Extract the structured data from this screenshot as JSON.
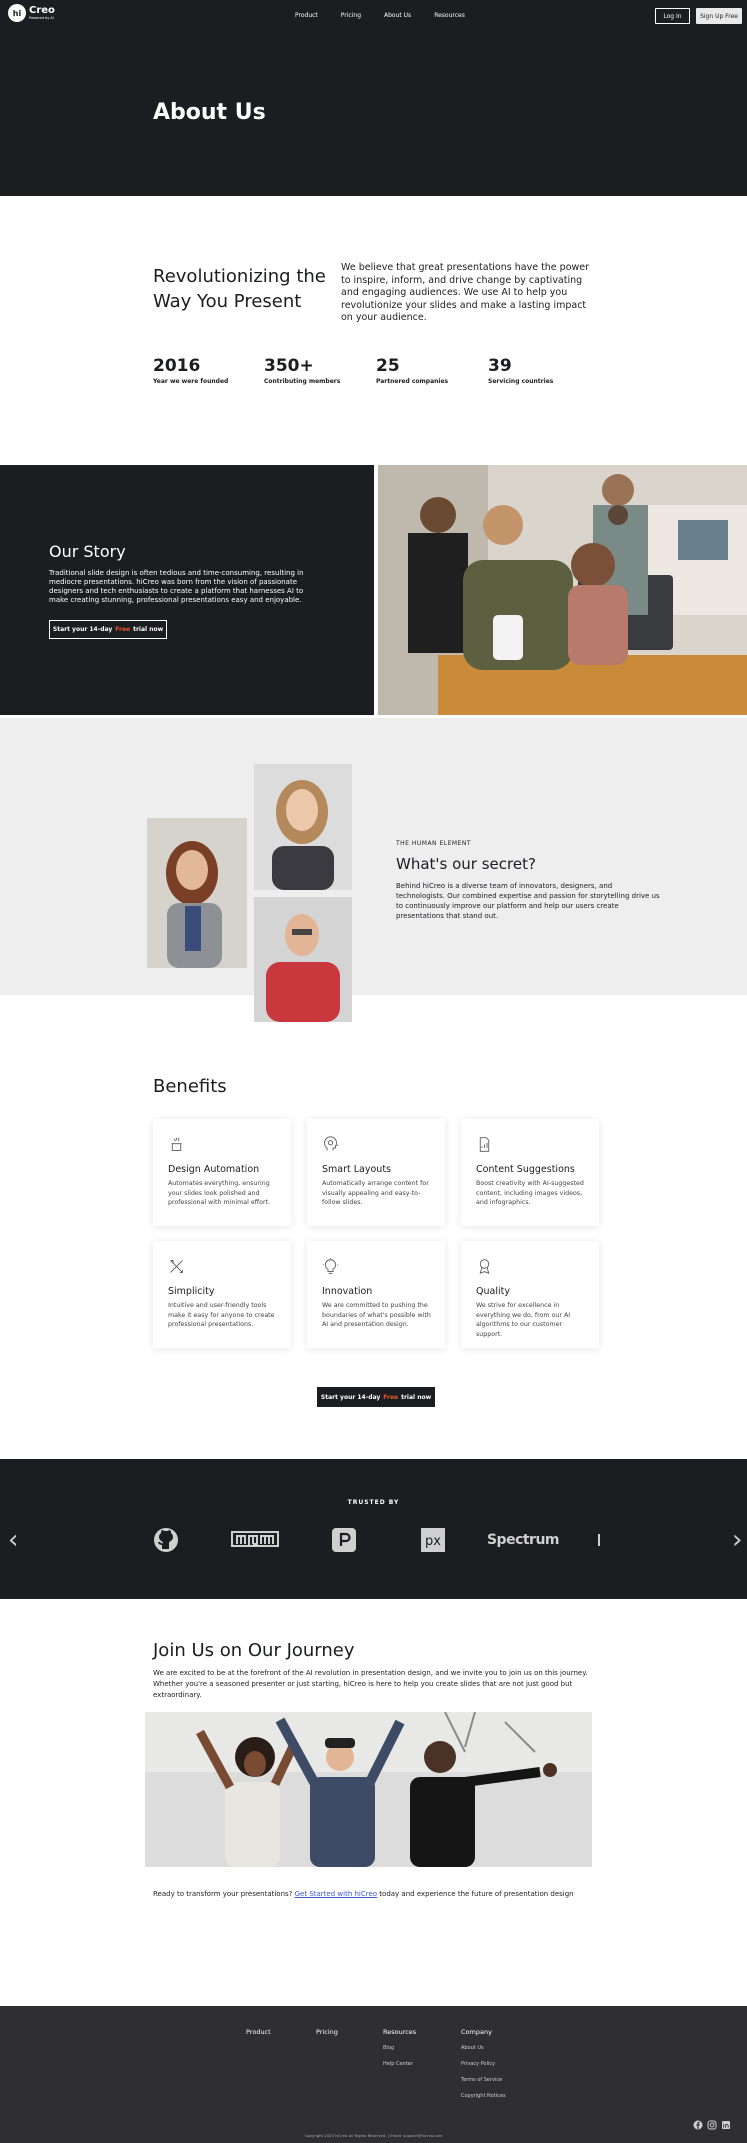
{
  "header": {
    "logo_mark": "hi",
    "logo_name": "Creo",
    "logo_sub": "Powered by AI",
    "nav": [
      "Product",
      "Pricing",
      "About Us",
      "Resources"
    ],
    "login": "Log In",
    "signup": "Sign Up Free"
  },
  "hero": {
    "title": "About Us"
  },
  "intro": {
    "title": "Revolutionizing the Way You Present",
    "text": "We believe that great presentations have the power to inspire, inform, and drive change by captivating and engaging audiences. We use AI to help you revolutionize your slides and make a lasting impact on your audience.",
    "stats": [
      {
        "value": "2016",
        "label": "Year we were founded"
      },
      {
        "value": "350+",
        "label": "Contributing members"
      },
      {
        "value": "25",
        "label": "Partnered companies"
      },
      {
        "value": "39",
        "label": "Servicing countries"
      }
    ]
  },
  "story": {
    "title": "Our Story",
    "text": "Traditional slide design is often tedious and time-consuming, resulting in mediocre presentations. hiCreo was born from the vision of passionate designers and tech enthusiasts to create a platform that harnesses AI to make creating stunning, professional presentations easy and enjoyable.",
    "btn_pre": "Start your 14-day",
    "btn_free": "Free",
    "btn_post": "trial now"
  },
  "secret": {
    "eyebrow": "THE HUMAN ELEMENT",
    "title": "What's our secret?",
    "text": "Behind hiCreo is a diverse team of innovators, designers, and technologists. Our combined expertise and passion for storytelling drive us to continuously improve our platform and help our users create presentations that stand out."
  },
  "benefits": {
    "title": "Benefits",
    "cards": [
      {
        "title": "Design Automation",
        "text": "Automates everything, ensuring your slides look polished and professional with minimal effort.",
        "icon": "magic-hat-icon"
      },
      {
        "title": "Smart Layouts",
        "text": "Automatically arrange content for visually appealing and easy-to-follow slides.",
        "icon": "brain-head-icon"
      },
      {
        "title": "Content Suggestions",
        "text": "Boost creativity with AI-suggested content, including images videos, and infographics.",
        "icon": "document-chart-icon"
      },
      {
        "title": "Simplicity",
        "text": "Intuitive and user-friendly tools make it easy for anyone to create professional presentations.",
        "icon": "tools-icon"
      },
      {
        "title": "Innovation",
        "text": "We are committed to pushing the boundaries of what's possible with AI and presentation design.",
        "icon": "lightbulb-icon"
      },
      {
        "title": "Quality",
        "text": "We strive for excellence in everything we do, from our AI algorithms to our customer support.",
        "icon": "award-icon"
      }
    ],
    "btn_pre": "Start your 14-day",
    "btn_free": "Free",
    "btn_post": "trial now"
  },
  "trusted": {
    "title": "TRUSTED BY",
    "brands": [
      "github-logo",
      "npm-logo",
      "producthunt-logo",
      "pixelapse-logo",
      "Spectrum"
    ]
  },
  "join": {
    "title": "Join Us on Our Journey",
    "text": "We are excited to be at the forefront of the AI revolution in presentation design, and we invite you to join us on this journey. Whether you're a seasoned presenter or just starting, hiCreo is here to help you create slides that are not just good but extraordinary.",
    "cta_pre": "Ready to transform your presentations?",
    "cta_link": "Get Started with hiCreo",
    "cta_post": "today and experience the future of presentation design"
  },
  "footer": {
    "columns": [
      {
        "head": "Product",
        "links": []
      },
      {
        "head": "Pricing",
        "links": []
      },
      {
        "head": "Resources",
        "links": [
          "Blog",
          "Help Center"
        ]
      },
      {
        "head": "Company",
        "links": [
          "About Us",
          "Privacy Policy",
          "Terms of Service",
          "Copyright Notices"
        ]
      }
    ],
    "copyright": "Copyright 2023 hiCreo All Rights Reserved. | Email: support@hicreo.com"
  },
  "colors": {
    "dark": "#1c1d21",
    "accent": "#e4572e",
    "link": "#3c57d6",
    "footer": "#2f2f31"
  }
}
